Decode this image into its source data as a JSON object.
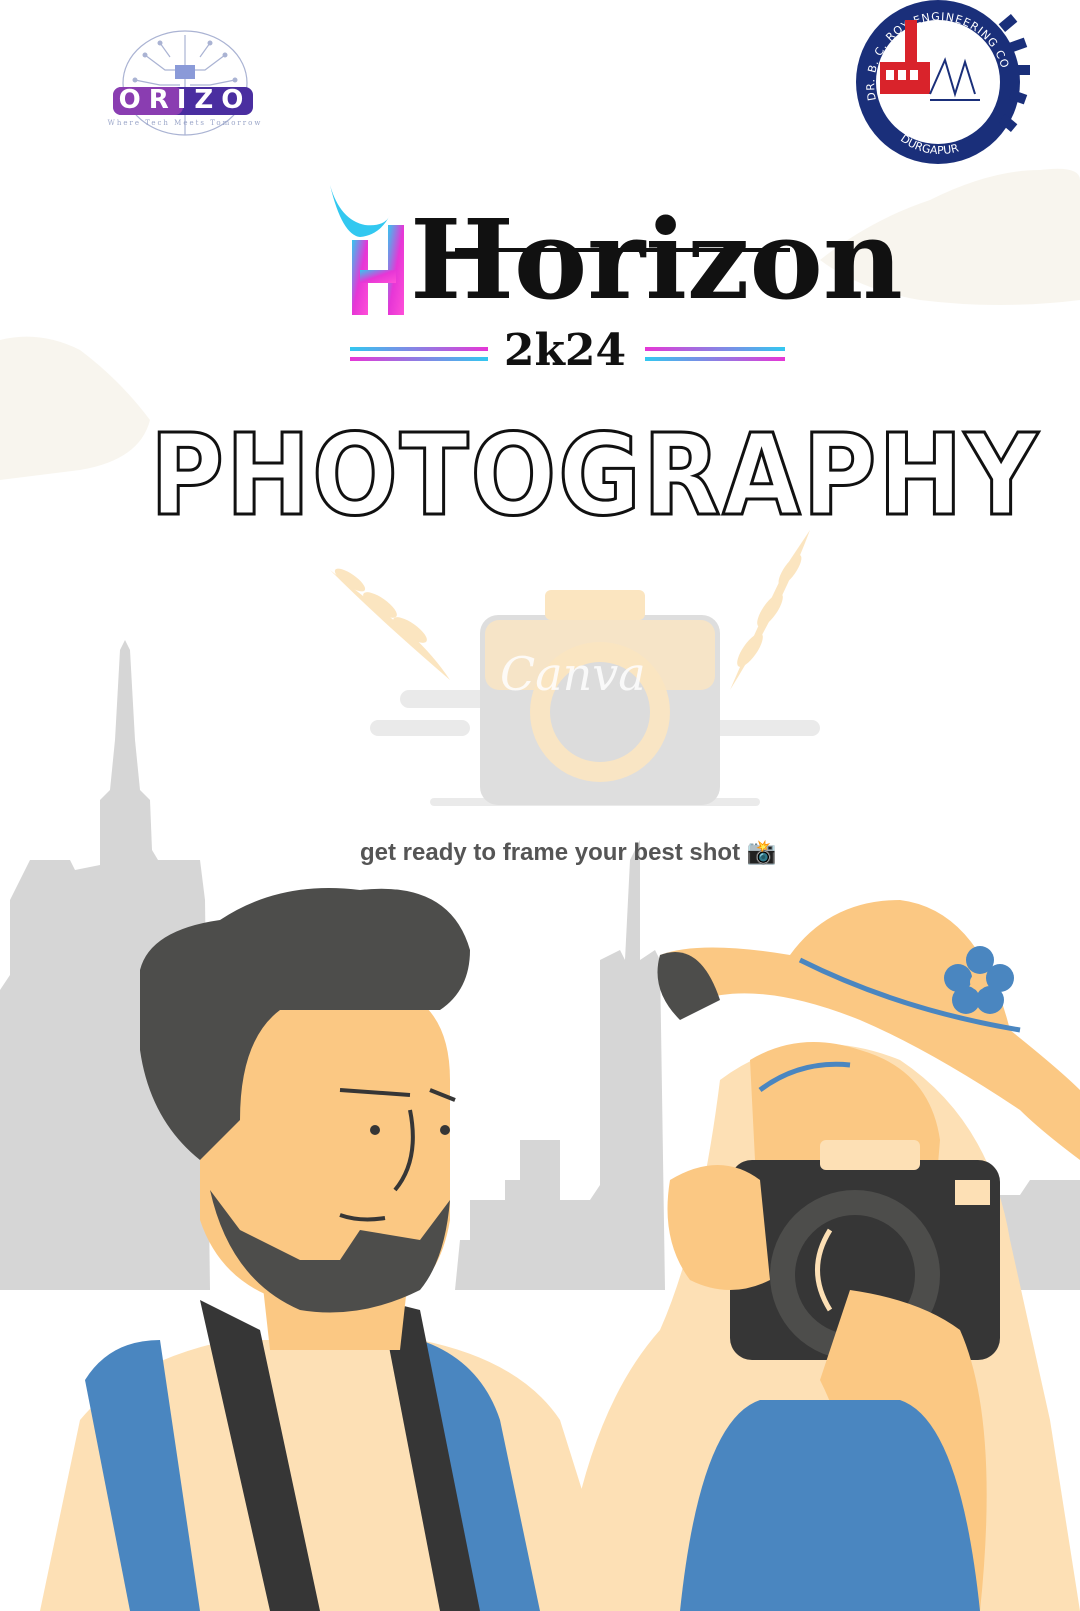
{
  "header": {
    "horizon_logo": {
      "letters": "HORIZON",
      "tagline": "Where Tech Meets Tomorrow"
    },
    "college_logo": {
      "ring_text_top": "DR. B. C. ROY ENGINEERING COLLEGE",
      "ring_text_bottom": "DURGAPUR"
    }
  },
  "event": {
    "brand": "Horizon",
    "year": "2k24",
    "category": "PHOTOGRAPHY",
    "tagline": "get ready to frame your best shot 📸",
    "watermark": "Canva"
  },
  "colors": {
    "gradient_pink": "#e636d6",
    "gradient_cyan": "#32c8f0",
    "college_blue": "#1a2f7a",
    "skin": "#fbc883",
    "skin_light": "#fde0b5",
    "hair": "#4d4d4b",
    "blue": "#4a86c0",
    "city_gray": "#d6d6d6"
  },
  "icons": [
    "camera-icon",
    "laurel-icon",
    "flower-icon",
    "gear-icon",
    "factory-icon"
  ]
}
